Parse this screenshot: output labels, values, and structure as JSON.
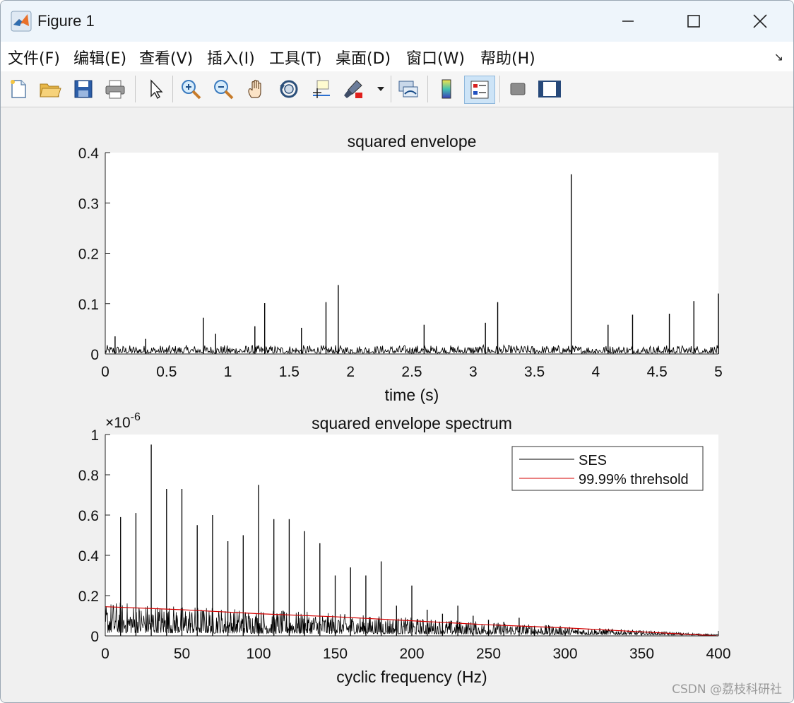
{
  "window": {
    "title": "Figure 1"
  },
  "menu": {
    "items": [
      "文件(F)",
      "编辑(E)",
      "查看(V)",
      "插入(I)",
      "工具(T)",
      "桌面(D)",
      "窗口(W)",
      "帮助(H)"
    ],
    "overflow_arrow": "↘"
  },
  "toolbar": {
    "icons": [
      "new-figure-icon",
      "open-file-icon",
      "save-icon",
      "print-icon",
      "pointer-icon",
      "zoom-in-icon",
      "zoom-out-icon",
      "pan-hand-icon",
      "rotate-3d-icon",
      "data-cursor-icon",
      "brush-icon",
      "link-plot-icon",
      "colorbar-icon",
      "legend-icon",
      "hide-plot-tools-icon",
      "show-plot-tools-icon"
    ]
  },
  "colors": {
    "line": "#000000",
    "threshold": "#d40000",
    "axes_bg": "#ffffff",
    "figure_bg": "#f0f0f0"
  },
  "chart_data": [
    {
      "type": "line",
      "title": "squared envelope",
      "xlabel": "time (s)",
      "ylabel": "",
      "xlim": [
        0,
        5
      ],
      "ylim": [
        0,
        0.4
      ],
      "xticks": [
        "0",
        "0.5",
        "1",
        "1.5",
        "2",
        "2.5",
        "3",
        "3.5",
        "4",
        "4.5",
        "5"
      ],
      "yticks": [
        "0",
        "0.1",
        "0.2",
        "0.3",
        "0.4"
      ],
      "grid": false,
      "series": [
        {
          "baseline_level": 0.005,
          "spikes_x": [
            0.08,
            0.33,
            0.8,
            0.9,
            1.22,
            1.3,
            1.6,
            1.8,
            1.9,
            2.6,
            3.1,
            3.2,
            3.8,
            4.1,
            4.3,
            4.6,
            4.8,
            5.0
          ],
          "spikes_y": [
            0.035,
            0.03,
            0.072,
            0.04,
            0.055,
            0.101,
            0.052,
            0.103,
            0.137,
            0.058,
            0.062,
            0.103,
            0.357,
            0.058,
            0.078,
            0.08,
            0.105,
            0.12
          ]
        }
      ]
    },
    {
      "type": "line",
      "title": "squared envelope spectrum",
      "xlabel": "cyclic frequency (Hz)",
      "ylabel": "",
      "exponent_label": "×10",
      "exponent_power": "-6",
      "xlim": [
        0,
        400
      ],
      "ylim": [
        0,
        1
      ],
      "xticks": [
        "0",
        "50",
        "100",
        "150",
        "200",
        "250",
        "300",
        "350",
        "400"
      ],
      "yticks": [
        "0",
        "0.2",
        "0.4",
        "0.6",
        "0.8",
        "1"
      ],
      "grid": false,
      "legend_position": "top-right",
      "series": [
        {
          "name": "SES",
          "peaks_x": [
            10,
            20,
            30,
            40,
            50,
            60,
            70,
            80,
            90,
            100,
            110,
            120,
            130,
            140,
            150,
            160,
            170,
            180,
            190,
            200,
            210,
            220,
            230,
            240,
            250,
            260,
            270,
            280,
            290,
            300
          ],
          "peaks_y": [
            0.59,
            0.61,
            0.95,
            0.73,
            0.73,
            0.55,
            0.6,
            0.47,
            0.5,
            0.75,
            0.58,
            0.58,
            0.52,
            0.46,
            0.3,
            0.34,
            0.3,
            0.37,
            0.15,
            0.25,
            0.13,
            0.11,
            0.15,
            0.1,
            0.08,
            0.07,
            0.09,
            0.05,
            0.05,
            0.04
          ]
        },
        {
          "name": "99.99% threhsold",
          "x": [
            0,
            50,
            100,
            150,
            200,
            250,
            300,
            350,
            400
          ],
          "y": [
            0.145,
            0.13,
            0.11,
            0.095,
            0.075,
            0.055,
            0.04,
            0.02,
            0.0
          ]
        }
      ]
    }
  ],
  "watermark": "CSDN @荔枝科研社"
}
